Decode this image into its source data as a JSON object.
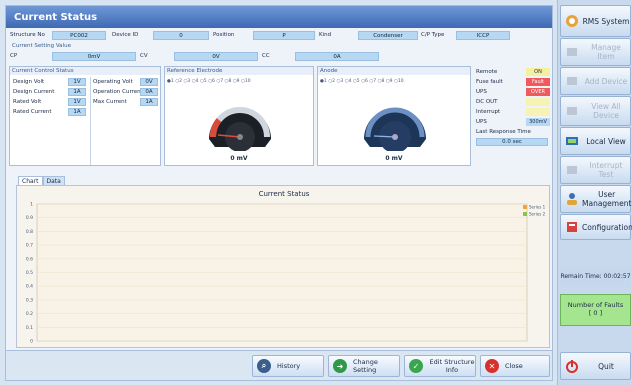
{
  "title": "Current Status",
  "info_row": {
    "structure_no_label": "Structure No",
    "structure_no": "PC002",
    "device_id_label": "Device ID",
    "device_id": "0",
    "position_label": "Position",
    "position": "P",
    "kind_label": "Kind",
    "kind": "Condenser",
    "cp_type_label": "C/P Type",
    "cp_type": "ICCP"
  },
  "setting": {
    "section_label": "Current Setting Value",
    "cp_label": "CP",
    "cp": "0mV",
    "cv_label": "CV",
    "cv": "0V",
    "cc_label": "CC",
    "cc": "0A"
  },
  "control": {
    "title": "Current Control Status",
    "design_volt_label": "Design Volt",
    "design_volt": "1V",
    "design_current_label": "Design Current",
    "design_current": "1A",
    "rated_volt_label": "Rated Volt",
    "rated_volt": "1V",
    "rated_current_label": "Rated Current",
    "rated_current": "1A",
    "operating_volt_label": "Operating Volt",
    "operating_volt": "0V",
    "operation_current_label": "Operation Current",
    "operation_current": "0A",
    "max_current_label": "Max Current",
    "max_current": "1A"
  },
  "reference": {
    "title": "Reference Electrode",
    "ticks": "●1  ○2  ○3  ○4  ○5  ○6  ○7  ○8  ○9  ○10",
    "value": "0 mV"
  },
  "anode": {
    "title": "Anode",
    "ticks": "●1  ○2  ○3  ○4  ○5  ○6  ○7  ○8  ○9  ○10",
    "value": "0 mV"
  },
  "status": {
    "remote_label": "Remote",
    "remote": "ON",
    "fuse_label": "Fuse fault",
    "fuse": "Fault",
    "ups_label": "UPS",
    "ups": "OVER",
    "dcout_label": "DC OUT",
    "dcout": "",
    "interrupt_label": "Interrupt",
    "interrupt": "",
    "ups2_label": "UPS",
    "ups2": "300mV",
    "response_label": "Last Response Time",
    "response": "0.0 sec",
    "colors": {
      "on": "#f5f0a0",
      "fault": "#f05a5a",
      "over": "#f05a5a",
      "empty": "#f7f3b4"
    }
  },
  "tabs": [
    "Chart",
    "Data"
  ],
  "chart_data": {
    "type": "line",
    "title": "Current Status",
    "y_ticks": [
      "1",
      "0.9",
      "0.8",
      "0.7",
      "0.6",
      "0.5",
      "0.4",
      "0.3",
      "0.2",
      "0.1",
      "0"
    ],
    "ylim": [
      0,
      1
    ],
    "series": [
      {
        "name": "Series 1",
        "color": "#f2a23a",
        "values": []
      },
      {
        "name": "Series 2",
        "color": "#8bc34a",
        "values": []
      }
    ],
    "legend": "top-right"
  },
  "buttons": {
    "history": "History",
    "change_setting": "Change Setting",
    "edit_info": "Edit Structure Info",
    "close": "Close"
  },
  "sidebar": {
    "rms_system": "RMS System",
    "manage_item": "Manage Item",
    "add_device": "Add Device",
    "view_all_device": "View All Device",
    "local_view": "Local View",
    "interrupt_test": "Interrupt Test",
    "user_management": "User Management",
    "configuration": "Configuration",
    "remain_time": "Remain Time: 00:02:57",
    "faults_label": "Number of Faults",
    "faults_count": "[ 0 ]",
    "quit": "Quit"
  }
}
